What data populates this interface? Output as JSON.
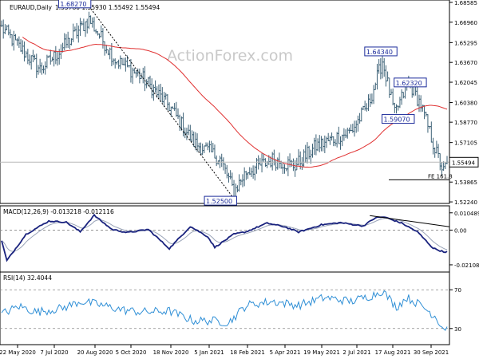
{
  "chart_data": [
    {
      "type": "ohlc",
      "title": "EURAUD,Daily",
      "ohlc_text": "1.55780 1.55930 1.55492 1.55494",
      "symbol": "EURAUD",
      "timeframe": "Daily",
      "last_price": "1.55494",
      "ylim": [
        1.52245,
        1.68585
      ],
      "y_ticks": [
        "1.68585",
        "1.66960",
        "1.65295",
        "1.63670",
        "1.62045",
        "1.60380",
        "1.58770",
        "1.57105",
        "1.55494",
        "1.53865",
        "1.52240"
      ],
      "x_ticks": [
        "22 May 2020",
        "7 Jul 2020",
        "20 Aug 2020",
        "5 Oct 2020",
        "18 Nov 2020",
        "5 Jan 2021",
        "18 Feb 2021",
        "5 Apr 2021",
        "19 May 2021",
        "2 Jul 2021",
        "17 Aug 2021",
        "30 Sep 2021"
      ],
      "moving_average_visible": true,
      "annotations": [
        {
          "label": "1.68270",
          "value": 1.6827,
          "date_index": 50
        },
        {
          "label": "1.52500",
          "value": 1.525,
          "date_index": 133
        },
        {
          "label": "1.64340",
          "value": 1.6434,
          "date_index": 217
        },
        {
          "label": "1.62320",
          "value": 1.6232,
          "date_index": 232
        },
        {
          "label": "1.59070",
          "value": 1.5907,
          "date_index": 226
        },
        {
          "label": "FE 161.8",
          "value": 1.5405
        }
      ],
      "key_points": [
        {
          "date_index": 0,
          "close": 1.665
        },
        {
          "date_index": 22,
          "close": 1.631
        },
        {
          "date_index": 32,
          "close": 1.644
        },
        {
          "date_index": 50,
          "close": 1.672
        },
        {
          "date_index": 65,
          "close": 1.639
        },
        {
          "date_index": 80,
          "close": 1.625
        },
        {
          "date_index": 96,
          "close": 1.601
        },
        {
          "date_index": 110,
          "close": 1.571
        },
        {
          "date_index": 125,
          "close": 1.558
        },
        {
          "date_index": 133,
          "close": 1.531
        },
        {
          "date_index": 140,
          "close": 1.547
        },
        {
          "date_index": 155,
          "close": 1.557
        },
        {
          "date_index": 168,
          "close": 1.552
        },
        {
          "date_index": 180,
          "close": 1.568
        },
        {
          "date_index": 200,
          "close": 1.58
        },
        {
          "date_index": 210,
          "close": 1.602
        },
        {
          "date_index": 218,
          "close": 1.638
        },
        {
          "date_index": 225,
          "close": 1.594
        },
        {
          "date_index": 233,
          "close": 1.621
        },
        {
          "date_index": 240,
          "close": 1.602
        },
        {
          "date_index": 248,
          "close": 1.566
        },
        {
          "date_index": 253,
          "close": 1.547
        },
        {
          "date_index": 255,
          "close": 1.5549
        }
      ]
    },
    {
      "type": "line",
      "title": "MACD(12,26,9) -0.013218 -0.012116",
      "y_ticks": [
        "0.010489",
        "0.00",
        "-0.021083"
      ],
      "ylim": [
        -0.0245,
        0.0128
      ],
      "series": [
        {
          "name": "MACD",
          "key_points": [
            [
              0,
              -0.0065
            ],
            [
              3,
              -0.0185
            ],
            [
              14,
              -0.0025
            ],
            [
              27,
              0.0055
            ],
            [
              37,
              0.0048
            ],
            [
              45,
              -0.001
            ],
            [
              53,
              0.009
            ],
            [
              63,
              0.0005
            ],
            [
              72,
              -0.0015
            ],
            [
              84,
              0.0004
            ],
            [
              96,
              -0.0112
            ],
            [
              108,
              0.0022
            ],
            [
              118,
              -0.004
            ],
            [
              122,
              -0.0105
            ],
            [
              133,
              -0.0025
            ],
            [
              140,
              -0.001
            ],
            [
              152,
              0.0042
            ],
            [
              162,
              0.002
            ],
            [
              170,
              -0.0012
            ],
            [
              183,
              0.0032
            ],
            [
              194,
              0.0045
            ],
            [
              207,
              0.0025
            ],
            [
              214,
              0.0075
            ],
            [
              219,
              0.008
            ],
            [
              229,
              0.0042
            ],
            [
              238,
              -0.001
            ],
            [
              247,
              -0.011
            ],
            [
              253,
              -0.0132
            ],
            [
              255,
              -0.0132
            ]
          ]
        },
        {
          "name": "Signal",
          "smooth_of": "MACD"
        }
      ],
      "annotations": [
        {
          "label": "divergence line",
          "from_index": 219,
          "to_index": 260
        }
      ]
    },
    {
      "type": "line",
      "title": "RSI(14) 32.4044",
      "y_ticks": [
        "70",
        "30"
      ],
      "ylim": [
        15,
        85
      ],
      "series": [
        {
          "name": "RSI",
          "key_points": [
            [
              0,
              45
            ],
            [
              10,
              53
            ],
            [
              20,
              47
            ],
            [
              35,
              51
            ],
            [
              45,
              58
            ],
            [
              55,
              55
            ],
            [
              70,
              49
            ],
            [
              80,
              47
            ],
            [
              96,
              48
            ],
            [
              110,
              38
            ],
            [
              122,
              38
            ],
            [
              130,
              36
            ],
            [
              140,
              54
            ],
            [
              155,
              58
            ],
            [
              170,
              54
            ],
            [
              185,
              62
            ],
            [
              200,
              58
            ],
            [
              212,
              64
            ],
            [
              218,
              69
            ],
            [
              226,
              52
            ],
            [
              232,
              62
            ],
            [
              240,
              54
            ],
            [
              248,
              43
            ],
            [
              253,
              30
            ],
            [
              255,
              32
            ]
          ]
        }
      ]
    }
  ],
  "watermark": "ActionForex.com"
}
